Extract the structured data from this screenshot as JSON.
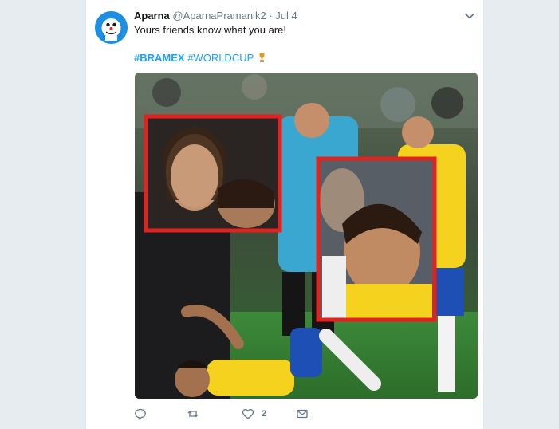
{
  "tweet": {
    "author_name": "Aparna",
    "handle": "@AparnaPramanik2",
    "separator": "·",
    "date": "Jul 4",
    "text": "Yours friends know what you are!",
    "hashtag_1": "#BRAMEX",
    "hashtag_2": "#WORLDCUP",
    "like_count": "2"
  },
  "icons": {
    "avatar": "cartoon-avatar",
    "more": "chevron-down-icon",
    "trophy": "trophy-emoji",
    "reply": "reply-icon",
    "retweet": "retweet-icon",
    "like": "heart-icon",
    "message": "envelope-icon"
  },
  "colors": {
    "link": "#1da1f2",
    "highlight_box": "#e0231e",
    "brazil_yellow": "#f5d21e",
    "brazil_blue": "#1e4fb4",
    "muted": "#657786"
  }
}
